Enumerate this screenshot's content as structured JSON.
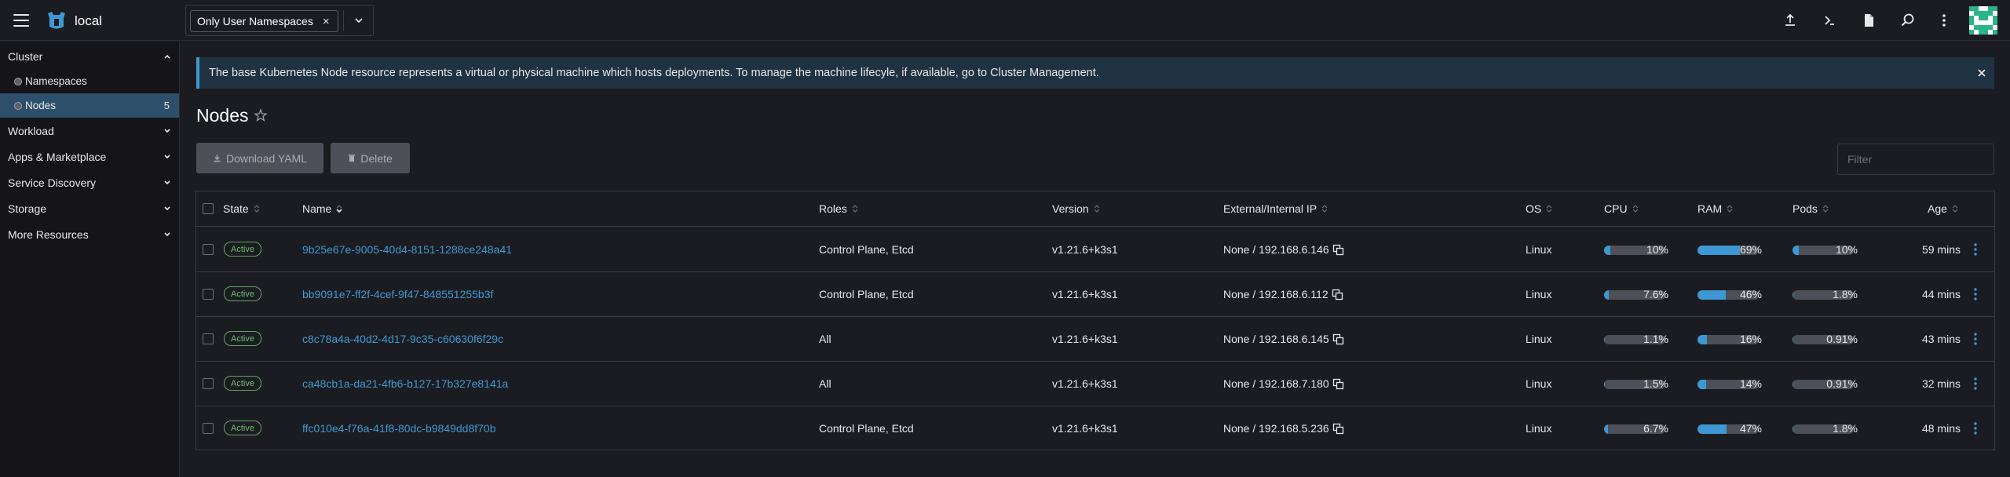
{
  "header": {
    "cluster_name": "local",
    "namespace_filter": "Only User Namespaces",
    "chip_remove": "×",
    "icons": [
      "upload-icon",
      "shell-icon",
      "file-icon",
      "search-icon",
      "more-vert-icon"
    ]
  },
  "sidebar": {
    "groups": [
      {
        "label": "Cluster",
        "expanded": true,
        "items": [
          {
            "label": "Namespaces",
            "count": ""
          },
          {
            "label": "Nodes",
            "count": "5",
            "active": true
          }
        ]
      },
      {
        "label": "Workload",
        "expanded": false
      },
      {
        "label": "Apps & Marketplace",
        "expanded": false
      },
      {
        "label": "Service Discovery",
        "expanded": false
      },
      {
        "label": "Storage",
        "expanded": false
      },
      {
        "label": "More Resources",
        "expanded": false
      }
    ]
  },
  "banner": {
    "text": "The base Kubernetes Node resource represents a virtual or physical machine which hosts deployments. To manage the machine lifecyle, if available, go to Cluster Management."
  },
  "page": {
    "title": "Nodes",
    "download_yaml": "Download YAML",
    "delete": "Delete",
    "filter_placeholder": "Filter"
  },
  "table": {
    "columns": [
      "State",
      "Name",
      "Roles",
      "Version",
      "External/Internal IP",
      "OS",
      "CPU",
      "RAM",
      "Pods",
      "Age"
    ],
    "rows": [
      {
        "state": "Active",
        "name": "9b25e67e-9005-40d4-8151-1288ce248a41",
        "roles": "Control Plane, Etcd",
        "version": "v1.21.6+k3s1",
        "ip": "None / 192.168.6.146",
        "os": "Linux",
        "cpu": 10,
        "cpu_label": "10%",
        "ram": 69,
        "ram_label": "69%",
        "pods": 10,
        "pods_label": "10%",
        "age": "59 mins"
      },
      {
        "state": "Active",
        "name": "bb9091e7-ff2f-4cef-9f47-848551255b3f",
        "roles": "Control Plane, Etcd",
        "version": "v1.21.6+k3s1",
        "ip": "None / 192.168.6.112",
        "os": "Linux",
        "cpu": 7.6,
        "cpu_label": "7.6%",
        "ram": 46,
        "ram_label": "46%",
        "pods": 1.8,
        "pods_label": "1.8%",
        "age": "44 mins"
      },
      {
        "state": "Active",
        "name": "c8c78a4a-40d2-4d17-9c35-c60630f6f29c",
        "roles": "All",
        "version": "v1.21.6+k3s1",
        "ip": "None / 192.168.6.145",
        "os": "Linux",
        "cpu": 1.1,
        "cpu_label": "1.1%",
        "ram": 16,
        "ram_label": "16%",
        "pods": 0.91,
        "pods_label": "0.91%",
        "age": "43 mins"
      },
      {
        "state": "Active",
        "name": "ca48cb1a-da21-4fb6-b127-17b327e8141a",
        "roles": "All",
        "version": "v1.21.6+k3s1",
        "ip": "None / 192.168.7.180",
        "os": "Linux",
        "cpu": 1.5,
        "cpu_label": "1.5%",
        "ram": 14,
        "ram_label": "14%",
        "pods": 0.91,
        "pods_label": "0.91%",
        "age": "32 mins"
      },
      {
        "state": "Active",
        "name": "ffc010e4-f76a-41f8-80dc-b9849dd8f70b",
        "roles": "Control Plane, Etcd",
        "version": "v1.21.6+k3s1",
        "ip": "None / 192.168.5.236",
        "os": "Linux",
        "cpu": 6.7,
        "cpu_label": "6.7%",
        "ram": 47,
        "ram_label": "47%",
        "pods": 1.8,
        "pods_label": "1.8%",
        "age": "48 mins"
      }
    ]
  },
  "colors": {
    "accent": "#3d98d3",
    "active_badge": "#6dbb6d",
    "sidebar_active": "#2e4f6b",
    "bar_track": "#4d5058"
  }
}
